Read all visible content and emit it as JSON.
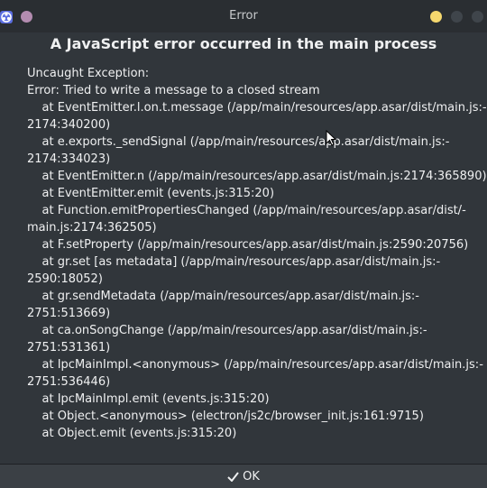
{
  "window": {
    "title": "Error",
    "accent_color": "#5b6ee1",
    "left_dot_color": "#b38cb0",
    "buttons": [
      {
        "name": "minimize-button",
        "color": "#f5d86e"
      },
      {
        "name": "maximize-button",
        "color": "#3f454b"
      },
      {
        "name": "close-button",
        "color": "#3f454b"
      }
    ]
  },
  "dialog": {
    "heading": "A JavaScript error occurred in the main process",
    "message_lines": [
      "Uncaught Exception:",
      "Error: Tried to write a message to a closed stream",
      "    at EventEmitter.l.on.t.message (/app/main/resources/app.asar/dist/main.js:-",
      "2174:340200)",
      "    at e.exports._sendSignal (/app/main/resources/app.asar/dist/main.js:-",
      "2174:334023)",
      "    at EventEmitter.n (/app/main/resources/app.asar/dist/main.js:2174:365890)",
      "    at EventEmitter.emit (events.js:315:20)",
      "    at Function.emitPropertiesChanged (/app/main/resources/app.asar/dist/-",
      "main.js:2174:362505)",
      "    at F.setProperty (/app/main/resources/app.asar/dist/main.js:2590:20756)",
      "    at gr.set [as metadata] (/app/main/resources/app.asar/dist/main.js:-",
      "2590:18052)",
      "    at gr.sendMetadata (/app/main/resources/app.asar/dist/main.js:-",
      "2751:513669)",
      "    at ca.onSongChange (/app/main/resources/app.asar/dist/main.js:-",
      "2751:531361)",
      "    at IpcMainImpl.<anonymous> (/app/main/resources/app.asar/dist/main.js:-",
      "2751:536446)",
      "    at IpcMainImpl.emit (events.js:315:20)",
      "    at Object.<anonymous> (electron/js2c/browser_init.js:161:9715)",
      "    at Object.emit (events.js:315:20)"
    ],
    "ok_label": "OK",
    "ok_icon": "check-icon"
  }
}
